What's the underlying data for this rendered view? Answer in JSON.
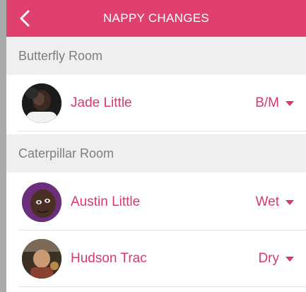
{
  "header": {
    "back_icon": "chevron-left-icon",
    "title": "NAPPY CHANGES"
  },
  "colors": {
    "accent": "#e0406e",
    "text_accent": "#d9386b",
    "section_bg": "#efefef",
    "section_text": "#7e7e7e"
  },
  "rooms": [
    {
      "name": "Butterfly Room",
      "children": [
        {
          "name": "Jade Little",
          "status": "B/M",
          "status_icon": "caret-down-icon"
        }
      ]
    },
    {
      "name": "Caterpillar Room",
      "children": [
        {
          "name": "Austin Little",
          "status": "Wet",
          "status_icon": "caret-down-icon"
        },
        {
          "name": "Hudson Trac",
          "status": "Dry",
          "status_icon": "caret-down-icon"
        }
      ]
    }
  ]
}
